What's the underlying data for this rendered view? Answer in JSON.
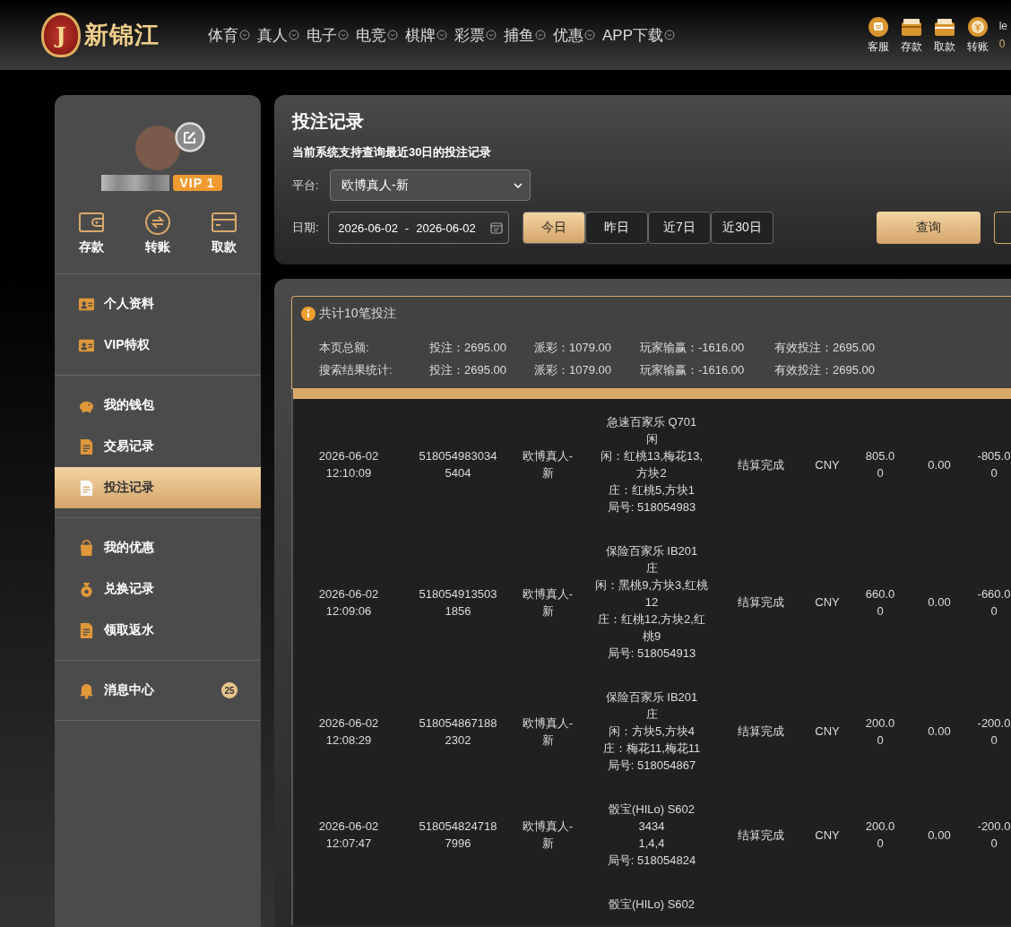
{
  "header": {
    "logo_text": "新锦江",
    "logo_mark": "J",
    "nav": [
      {
        "label": "体育"
      },
      {
        "label": "真人"
      },
      {
        "label": "电子"
      },
      {
        "label": "电竞"
      },
      {
        "label": "棋牌"
      },
      {
        "label": "彩票"
      },
      {
        "label": "捕鱼"
      },
      {
        "label": "优惠"
      },
      {
        "label": "APP下载"
      }
    ],
    "actions": [
      {
        "label": "客服",
        "kind": "service"
      },
      {
        "label": "存款",
        "kind": "deposit"
      },
      {
        "label": "取款",
        "kind": "withdraw"
      },
      {
        "label": "转账",
        "kind": "transfer"
      }
    ],
    "user_partial": "le",
    "balance_partial": "0"
  },
  "sidebar": {
    "vip": "VIP 1",
    "quick_actions": [
      {
        "label": "存款",
        "kind": "wallet"
      },
      {
        "label": "转账",
        "kind": "transfer"
      },
      {
        "label": "取款",
        "kind": "card"
      }
    ],
    "sections": [
      {
        "items": [
          {
            "label": "个人资料",
            "kind": "profile",
            "selected": false
          },
          {
            "label": "VIP特权",
            "kind": "profile",
            "selected": false
          }
        ]
      },
      {
        "items": [
          {
            "label": "我的钱包",
            "kind": "piggy",
            "selected": false
          },
          {
            "label": "交易记录",
            "kind": "doc",
            "selected": false
          },
          {
            "label": "投注记录",
            "kind": "doc",
            "selected": true
          }
        ]
      },
      {
        "items": [
          {
            "label": "我的优惠",
            "kind": "bag",
            "selected": false
          },
          {
            "label": "兑换记录",
            "kind": "moneybag",
            "selected": false
          },
          {
            "label": "领取返水",
            "kind": "doc",
            "selected": false
          }
        ]
      },
      {
        "items": [
          {
            "label": "消息中心",
            "kind": "bell",
            "selected": false,
            "badge": "25"
          }
        ]
      }
    ]
  },
  "query": {
    "title": "投注记录",
    "notice": "当前系统支持查询最近30日的投注记录",
    "platform_label": "平台:",
    "platform_value": "欧博真人-新",
    "date_label": "日期:",
    "date_from": "2026-06-02",
    "date_sep": "-",
    "date_to": "2026-06-02",
    "ranges": [
      {
        "label": "今日",
        "selected": true
      },
      {
        "label": "昨日",
        "selected": false
      },
      {
        "label": "近7日",
        "selected": false
      },
      {
        "label": "近30日",
        "selected": false
      }
    ],
    "submit": "查询"
  },
  "summary": {
    "count": "共计10笔投注",
    "rows": [
      {
        "label": "本页总额:",
        "bet": "投注：2695.00",
        "payout": "派彩：1079.00",
        "winloss": "玩家输赢：-1616.00",
        "valid": "有效投注：2695.00"
      },
      {
        "label": "搜索结果统计:",
        "bet": "投注：2695.00",
        "payout": "派彩：1079.00",
        "winloss": "玩家输赢：-1616.00",
        "valid": "有效投注：2695.00"
      }
    ]
  },
  "table": {
    "rows": [
      {
        "time": "2026-06-02 12:10:09",
        "order": "5180549830345404",
        "platform": "欧博真人-新",
        "details": [
          "急速百家乐 Q701",
          "闲",
          "闲：红桃13,梅花13,方块2",
          "庄：红桃5,方块1",
          "局号: 518054983"
        ],
        "status": "结算完成",
        "currency": "CNY",
        "bet": "805.00",
        "payout": "0.00",
        "winloss": "-805.00"
      },
      {
        "time": "2026-06-02 12:09:06",
        "order": "5180549135031856",
        "platform": "欧博真人-新",
        "details": [
          "保险百家乐 IB201",
          "庄",
          "闲：黑桃9,方块3,红桃12",
          "庄：红桃12,方块2,红桃9",
          "局号: 518054913"
        ],
        "status": "结算完成",
        "currency": "CNY",
        "bet": "660.00",
        "payout": "0.00",
        "winloss": "-660.00"
      },
      {
        "time": "2026-06-02 12:08:29",
        "order": "5180548671882302",
        "platform": "欧博真人-新",
        "details": [
          "保险百家乐 IB201",
          "庄",
          "闲：方块5,方块4",
          "庄：梅花11,梅花11",
          "局号: 518054867"
        ],
        "status": "结算完成",
        "currency": "CNY",
        "bet": "200.00",
        "payout": "0.00",
        "winloss": "-200.00"
      },
      {
        "time": "2026-06-02 12:07:47",
        "order": "5180548247187996",
        "platform": "欧博真人-新",
        "details": [
          "骰宝(HILo) S602",
          "3434",
          "1,4,4",
          "局号: 518054824"
        ],
        "status": "结算完成",
        "currency": "CNY",
        "bet": "200.00",
        "payout": "0.00",
        "winloss": "-200.00"
      },
      {
        "details": [
          "骰宝(HILo) S602"
        ]
      }
    ]
  }
}
